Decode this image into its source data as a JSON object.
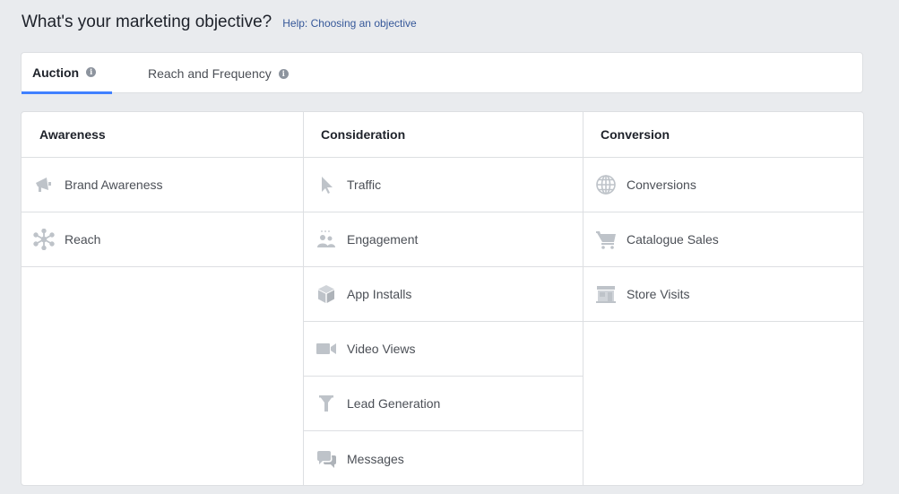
{
  "header": {
    "title": "What's your marketing objective?",
    "help_link": "Help: Choosing an objective"
  },
  "tabs": [
    {
      "label": "Auction",
      "active": true
    },
    {
      "label": "Reach and Frequency",
      "active": false
    }
  ],
  "columns": [
    {
      "heading": "Awareness",
      "items": [
        {
          "label": "Brand Awareness",
          "icon": "megaphone-icon"
        },
        {
          "label": "Reach",
          "icon": "reach-icon"
        }
      ]
    },
    {
      "heading": "Consideration",
      "items": [
        {
          "label": "Traffic",
          "icon": "cursor-icon"
        },
        {
          "label": "Engagement",
          "icon": "people-icon"
        },
        {
          "label": "App Installs",
          "icon": "box-icon"
        },
        {
          "label": "Video Views",
          "icon": "video-camera-icon"
        },
        {
          "label": "Lead Generation",
          "icon": "funnel-icon"
        },
        {
          "label": "Messages",
          "icon": "chat-bubbles-icon"
        }
      ]
    },
    {
      "heading": "Conversion",
      "items": [
        {
          "label": "Conversions",
          "icon": "globe-icon"
        },
        {
          "label": "Catalogue Sales",
          "icon": "cart-icon"
        },
        {
          "label": "Store Visits",
          "icon": "store-icon"
        }
      ]
    }
  ],
  "colors": {
    "icon": "#bec3c9",
    "active_tab_underline": "#4080ff",
    "link": "#365899"
  }
}
